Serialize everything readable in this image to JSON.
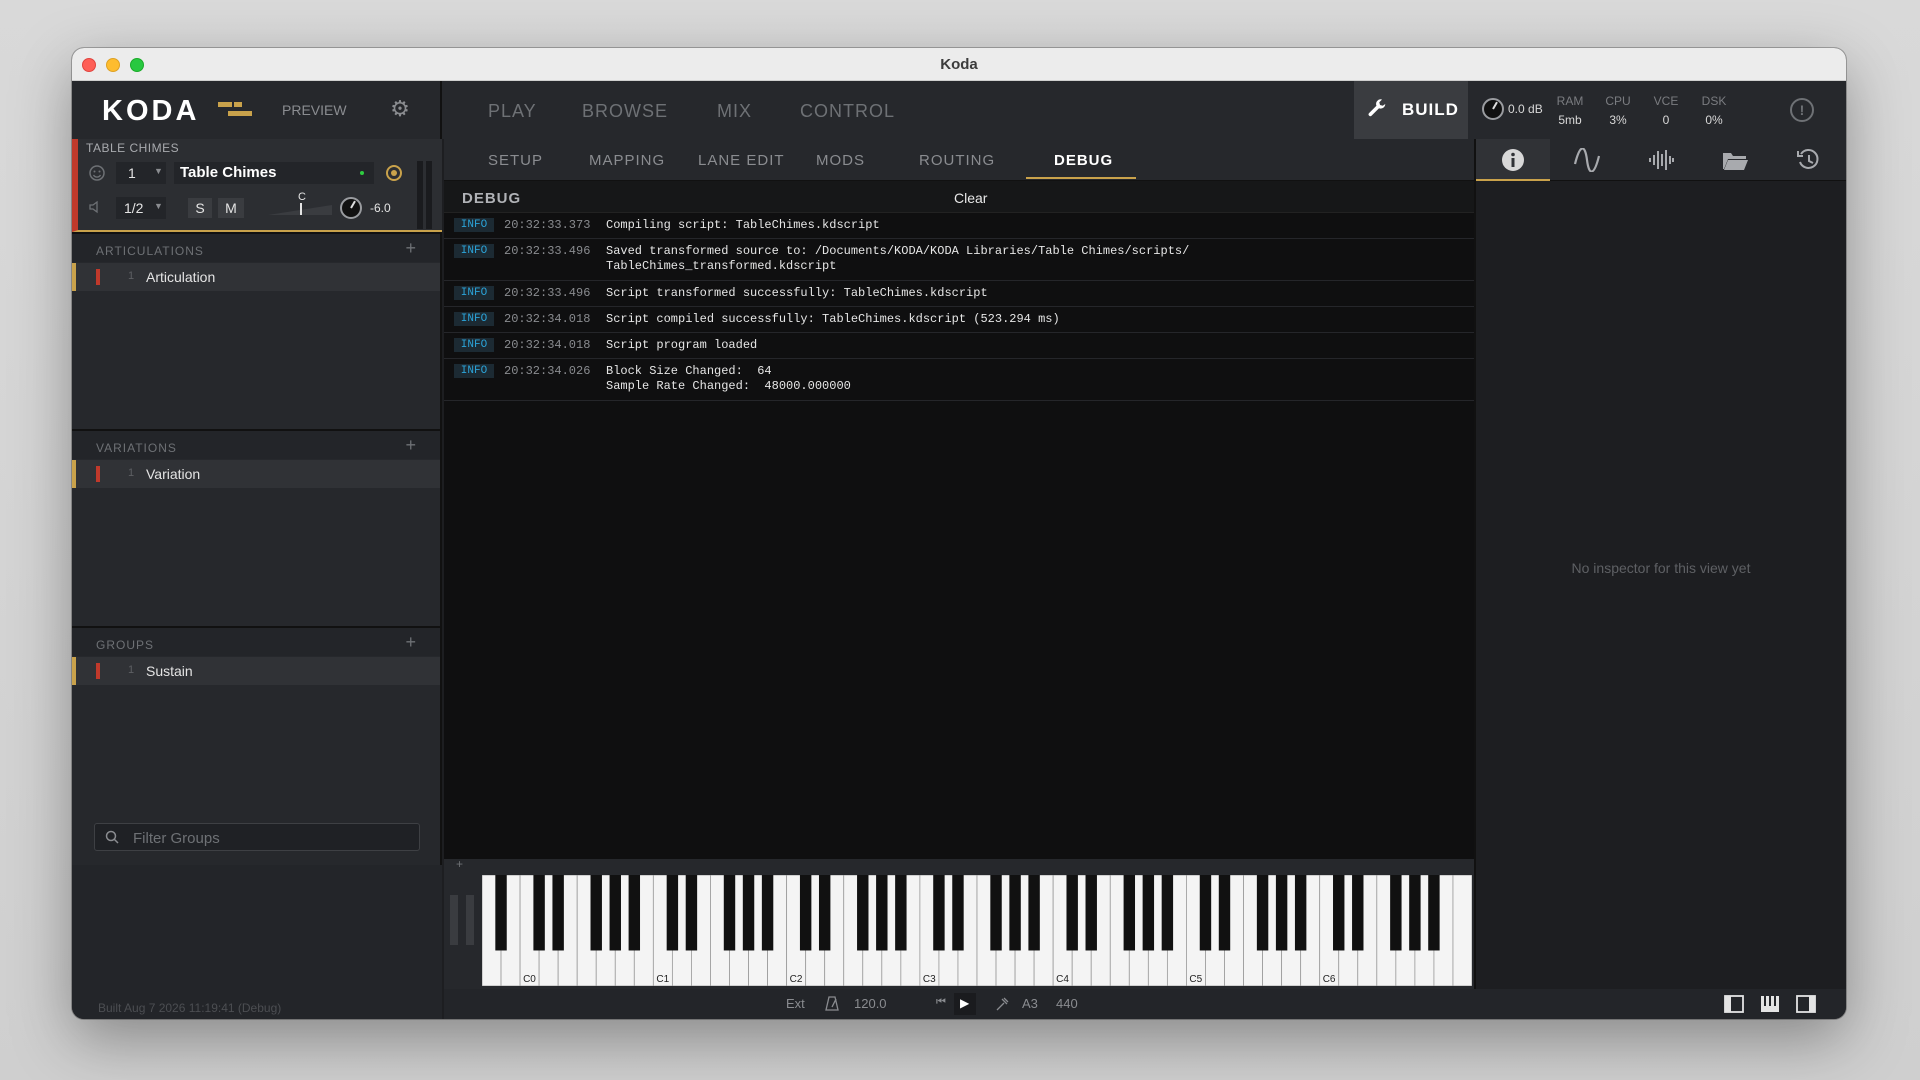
{
  "window": {
    "title": "Koda"
  },
  "header": {
    "logo": "KODA",
    "preview_label": "PREVIEW",
    "nav": [
      "PLAY",
      "BROWSE",
      "MIX",
      "CONTROL"
    ],
    "build_label": "BUILD",
    "volume": "0.0 dB",
    "stats": [
      {
        "label": "RAM",
        "value": "5mb"
      },
      {
        "label": "CPU",
        "value": "3%"
      },
      {
        "label": "VCE",
        "value": "0"
      },
      {
        "label": "DSK",
        "value": "0%"
      }
    ],
    "brand_color": "#c9a24b"
  },
  "instrument": {
    "section_title": "TABLE CHIMES",
    "midi_channel": "1",
    "name": "Table Chimes",
    "voice_ratio": "1/2",
    "solo": "S",
    "mute": "M",
    "pan_label": "C",
    "gain": "-6.0"
  },
  "articulations": {
    "title": "ARTICULATIONS",
    "add": "+",
    "items": [
      {
        "num": "1",
        "label": "Articulation"
      }
    ]
  },
  "variations": {
    "title": "VARIATIONS",
    "add": "+",
    "items": [
      {
        "num": "1",
        "label": "Variation"
      }
    ]
  },
  "groups": {
    "title": "GROUPS",
    "add": "+",
    "items": [
      {
        "num": "1",
        "label": "Sustain"
      }
    ]
  },
  "filter": {
    "placeholder": "Filter Groups"
  },
  "build_info": "Built Aug 7 2026 11:19:41 (Debug)",
  "subnav": {
    "tabs": [
      "SETUP",
      "MAPPING",
      "LANE EDIT",
      "MODS",
      "ROUTING",
      "DEBUG"
    ],
    "active": "DEBUG"
  },
  "debug": {
    "title": "DEBUG",
    "clear_label": "Clear",
    "logs": [
      {
        "level": "INFO",
        "time": "20:32:33.373",
        "message": "Compiling script: TableChimes.kdscript"
      },
      {
        "level": "INFO",
        "time": "20:32:33.496",
        "message": "Saved transformed source to: /Documents/KODA/KODA Libraries/Table Chimes/scripts/\nTableChimes_transformed.kdscript"
      },
      {
        "level": "INFO",
        "time": "20:32:33.496",
        "message": "Script transformed successfully: TableChimes.kdscript"
      },
      {
        "level": "INFO",
        "time": "20:32:34.018",
        "message": "Script compiled successfully: TableChimes.kdscript (523.294 ms)"
      },
      {
        "level": "INFO",
        "time": "20:32:34.018",
        "message": "Script program loaded"
      },
      {
        "level": "INFO",
        "time": "20:32:34.026",
        "message": "Block Size Changed:  64\nSample Rate Changed:  48000.000000"
      }
    ]
  },
  "keyboard": {
    "plus": "+",
    "octave_labels": [
      "C0",
      "C1",
      "C2",
      "C3",
      "C4",
      "C5",
      "C6"
    ]
  },
  "transport": {
    "sync": "Ext",
    "tempo": "120.0",
    "note": "A3",
    "tuning": "440"
  },
  "inspector": {
    "empty_text": "No inspector for this view yet"
  }
}
